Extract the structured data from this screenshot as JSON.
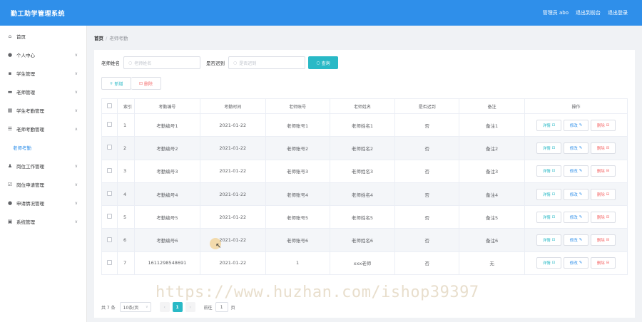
{
  "header": {
    "title": "勤工助学管理系统",
    "admin_label": "管理员 abo",
    "exit_front": "退出到前台",
    "logout": "退出登录"
  },
  "sidebar": {
    "items": [
      {
        "label": "首页",
        "icon": "home-icon",
        "expandable": false
      },
      {
        "label": "个人中心",
        "icon": "user-icon",
        "expandable": true
      },
      {
        "label": "学生管理",
        "icon": "student-icon",
        "expandable": true
      },
      {
        "label": "老师管理",
        "icon": "teacher-icon",
        "expandable": true
      },
      {
        "label": "学生考勤管理",
        "icon": "attendance-icon",
        "expandable": true
      },
      {
        "label": "老师考勤管理",
        "icon": "list-icon",
        "expandable": true,
        "expanded": true
      },
      {
        "label": "岗位工作管理",
        "icon": "job-icon",
        "expandable": true
      },
      {
        "label": "岗位申请管理",
        "icon": "apply-icon",
        "expandable": true
      },
      {
        "label": "申请情况管理",
        "icon": "location-icon",
        "expandable": true
      },
      {
        "label": "系统管理",
        "icon": "settings-icon",
        "expandable": true
      }
    ],
    "active_sub": "老师考勤"
  },
  "breadcrumb": {
    "home": "首页",
    "sep": "/",
    "current": "老师考勤"
  },
  "search": {
    "name_label": "老师姓名",
    "name_placeholder": "老师姓名",
    "late_label": "是否迟到",
    "late_placeholder": "是否迟到",
    "button": "查询"
  },
  "actions": {
    "add": "新增",
    "delete": "删除"
  },
  "table": {
    "headers": [
      "索引",
      "考勤编号",
      "考勤时间",
      "老师账号",
      "老师姓名",
      "是否迟到",
      "备注",
      "操作"
    ],
    "rows": [
      [
        "1",
        "考勤编号1",
        "2021-01-22",
        "老师账号1",
        "老师姓名1",
        "否",
        "备注1"
      ],
      [
        "2",
        "考勤编号2",
        "2021-01-22",
        "老师账号2",
        "老师姓名2",
        "否",
        "备注2"
      ],
      [
        "3",
        "考勤编号3",
        "2021-01-22",
        "老师账号3",
        "老师姓名3",
        "否",
        "备注3"
      ],
      [
        "4",
        "考勤编号4",
        "2021-01-22",
        "老师账号4",
        "老师姓名4",
        "否",
        "备注4"
      ],
      [
        "5",
        "考勤编号5",
        "2021-01-22",
        "老师账号5",
        "老师姓名5",
        "否",
        "备注5"
      ],
      [
        "6",
        "考勤编号6",
        "2021-01-22",
        "老师账号6",
        "老师姓名6",
        "否",
        "备注6"
      ],
      [
        "7",
        "1611298548691",
        "2021-01-22",
        "1",
        "xxx老师",
        "否",
        "无"
      ]
    ],
    "ops": {
      "detail": "详情",
      "edit": "修改",
      "remove": "删除"
    }
  },
  "pager": {
    "total": "共 7 条",
    "page_size": "10条/页",
    "current_page": "1",
    "goto_label": "前往",
    "goto_value": "1",
    "page_suffix": "页"
  },
  "watermark": "https://www.huzhan.com/ishop39397",
  "colors": {
    "header": "#2f8fea",
    "accent": "#29b9c6",
    "danger": "#f56c6c"
  }
}
